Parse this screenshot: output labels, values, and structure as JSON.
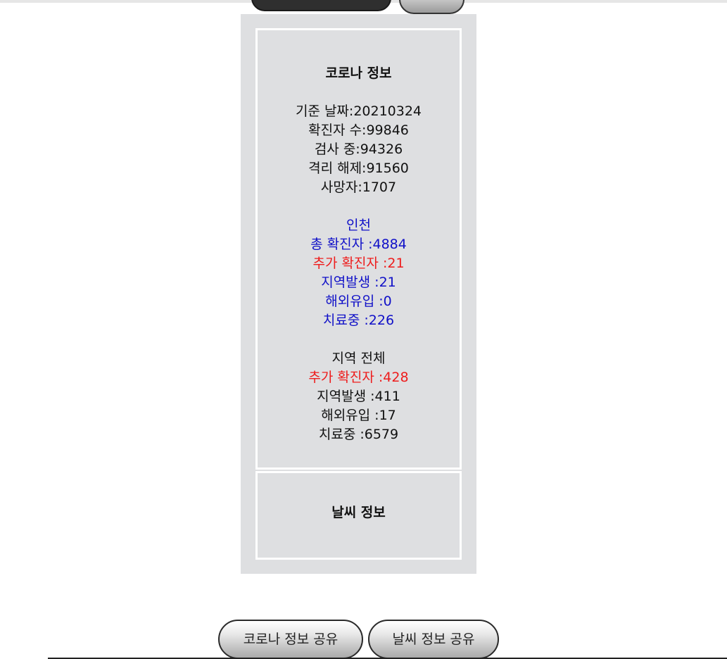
{
  "corona": {
    "title": "코로나 정보",
    "national": [
      "기준 날짜:20210324",
      "확진자 수:99846",
      "검사 중:94326",
      "격리 해제:91560",
      "사망자:1707"
    ],
    "incheon": {
      "name": "인천",
      "total": "총 확진자 :4884",
      "added": "추가 확진자 :21",
      "local": "지역발생 :21",
      "overseas": "해외유입 :0",
      "treating": "치료중 :226"
    },
    "region_all": {
      "name": "지역 전체",
      "added": "추가 확진자 :428",
      "local": "지역발생 :411",
      "overseas": "해외유입 :17",
      "treating": "치료중 :6579"
    }
  },
  "weather": {
    "title": "날씨 정보"
  },
  "buttons": {
    "share_corona": "코로나 정보 공유",
    "share_weather": "날씨 정보 공유"
  },
  "colors": {
    "incheon_text": "#1010c8",
    "added_text": "#ee1c1c",
    "panel_bg": "#dedfe1"
  }
}
